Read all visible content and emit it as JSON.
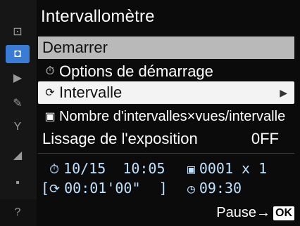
{
  "title": "Intervallomètre",
  "menu": {
    "start": "Demarrer",
    "start_options": "Options de démarrage",
    "interval": "Intervalle",
    "count": "Nombre d'intervalles×vues/intervalle",
    "exposure_smoothing": "Lissage de l'exposition",
    "exposure_smoothing_value": "0FF"
  },
  "info": {
    "start_date": "10/15",
    "start_time": "10:05",
    "interval_time": "00:01'00\"",
    "shots": "0001 x 1",
    "remaining_time": "09:30"
  },
  "footer": {
    "label": "Pause→",
    "ok": "OK"
  },
  "icons": {
    "playback": "playback-icon",
    "shooting": "camera-icon",
    "movie": "movie-icon",
    "custom": "pencil-icon",
    "setup": "wrench-icon",
    "retouch": "retouch-icon",
    "mymenu": "mymenu-icon",
    "help": "help-icon"
  }
}
